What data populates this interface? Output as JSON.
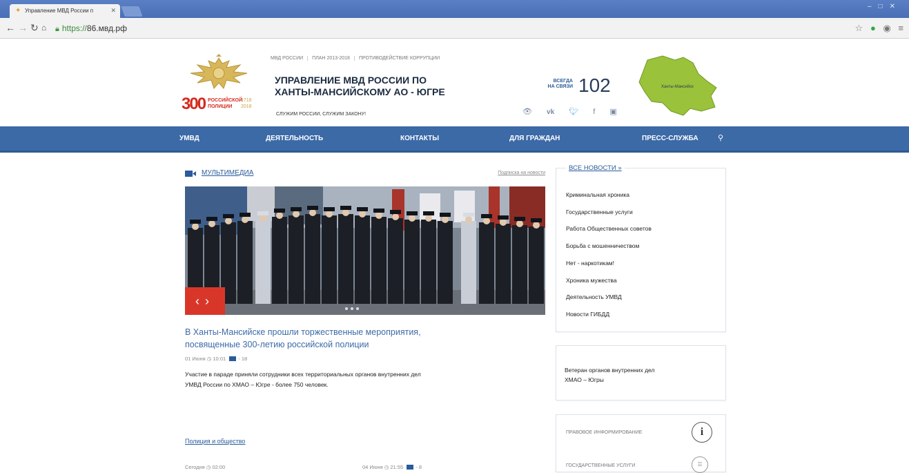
{
  "browser": {
    "tab_title": "Управление МВД России п",
    "url_prefix": "https://",
    "url_host": "86.мвд.рф"
  },
  "header": {
    "top_links": [
      "МВД РОССИИ",
      "ПЛАН 2013-2018",
      "ПРОТИВОДЕЙСТВИЕ КОРРУПЦИИ"
    ],
    "title_line1": "УПРАВЛЕНИЕ МВД РОССИИ ПО",
    "title_line2": "ХАНТЫ-МАНСИЙСКОМУ АО - ЮГРЕ",
    "slogan": "СЛУЖИМ РОССИИ, СЛУЖИМ ЗАКОНУ!",
    "logo300": {
      "number": "300",
      "line1": "РОССИЙСКОЙ",
      "line2": "ПОЛИЦИИ",
      "year1": "1718",
      "year2": "2018"
    },
    "hotline_label_1": "ВСЕГДА",
    "hotline_label_2": "НА СВЯЗИ",
    "hotline_number": "102",
    "map_label": "Ханты-Мансийск"
  },
  "nav": {
    "items": [
      "УМВД",
      "ДЕЯТЕЛЬНОСТЬ",
      "КОНТАКТЫ",
      "ДЛЯ ГРАЖДАН",
      "ПРЕСС-СЛУЖБА"
    ]
  },
  "multimedia": {
    "title": "МУЛЬТИМЕДИА",
    "subscribe": "Подписка на новости"
  },
  "news": {
    "title_line1": "В Ханты-Мансийске прошли торжественные мероприятия,",
    "title_line2": "посвященные 300-летию российской полиции",
    "date": "01 Июня",
    "time": "10:01",
    "photo_count": "- 18",
    "body_line1": "Участие в параде приняли сотрудники всех территориальных органов внутренних дел",
    "body_line2": "УМВД России по ХМАО – Югре - более 750 человек."
  },
  "section2": {
    "title": "Полиция и общество",
    "left_date": "Сегодня",
    "left_time": "02:00",
    "right_date": "04 Июня",
    "right_time": "21:55",
    "right_count": "- 8"
  },
  "sidebar": {
    "all_news": "ВСЕ НОВОСТИ »",
    "categories": [
      "Криминальная хроника",
      "Государственные услуги",
      "Работа Общественных советов",
      "Борьба с мошенничеством",
      "Нет - наркотикам!",
      "Хроника мужества",
      "Деятельность УМВД",
      "Новости ГИБДД"
    ],
    "veterans_line1": "Ветеран органов внутренних дел",
    "veterans_line2": "ХМАО – Югры",
    "legal_info": "ПРАВОВОЕ ИНФОРМИРОВАНИЕ",
    "gov_services": "ГОСУДАРСТВЕННЫЕ УСЛУГИ"
  },
  "colors": {
    "nav_bg": "#3c6aa7",
    "link": "#2a5b9a",
    "accent_red": "#d9362a"
  }
}
